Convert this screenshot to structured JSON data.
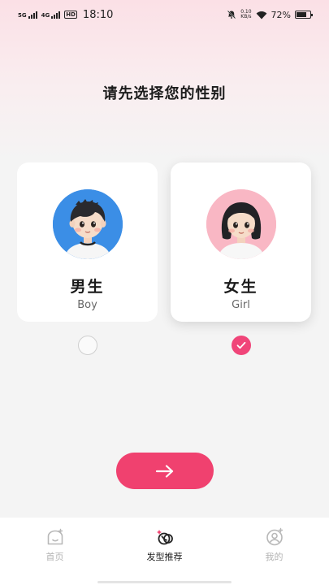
{
  "status_bar": {
    "sim1": "5G",
    "sim2": "4G",
    "hd": "HD",
    "time": "18:10",
    "net_speed_value": "0.10",
    "net_speed_unit": "KB/s",
    "battery_text": "72%",
    "battery_level": 0.72
  },
  "title": "请先选择您的性别",
  "cards": [
    {
      "name": "男生",
      "sub": "Boy",
      "selected": false
    },
    {
      "name": "女生",
      "sub": "Girl",
      "selected": true
    }
  ],
  "colors": {
    "accent": "#f0416f",
    "boy_avatar_bg": "#3b8ee6",
    "girl_avatar_bg": "#f9b7c4"
  },
  "next_button": {
    "icon": "arrow-right-icon"
  },
  "tabbar": {
    "items": [
      {
        "label": "首页",
        "icon": "home-icon",
        "active": false
      },
      {
        "label": "发型推荐",
        "icon": "hairstyle-icon",
        "active": true
      },
      {
        "label": "我的",
        "icon": "profile-icon",
        "active": false
      }
    ]
  }
}
